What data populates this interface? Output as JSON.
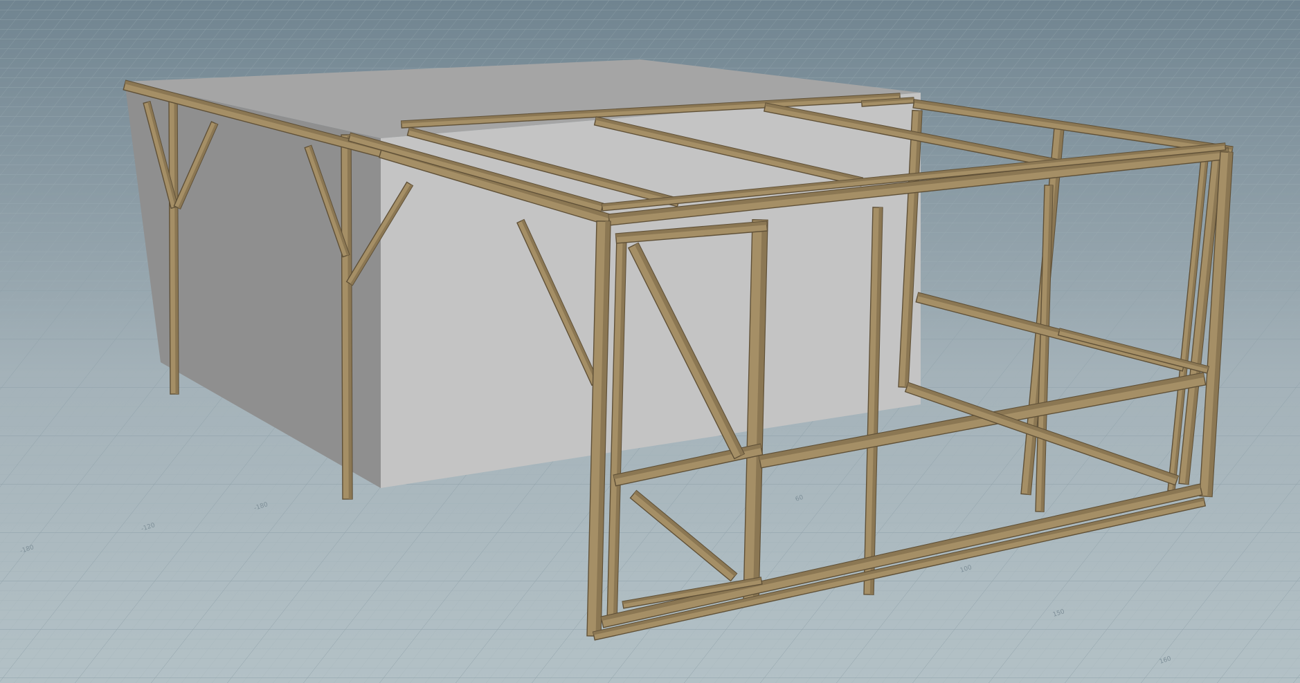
{
  "viewport": {
    "colors": {
      "sky_top": "#708490",
      "sky_bottom": "#a4b2b9",
      "grid_floor": "#b3c1c6",
      "grid_line_minor": "#9fb0b7",
      "grid_line_major": "#8a9ca5",
      "block_top": "#a5a5a5",
      "block_left": "#8f8f8f",
      "block_front": "#c4c4c4",
      "timber_light": "#a58f66",
      "timber_mid": "#8b7753",
      "timber_dark": "#5f5037"
    },
    "grid_labels": [
      "-180",
      "-120",
      "-180",
      "60",
      "100",
      "150",
      "160"
    ],
    "objects": {
      "block": "grey-block",
      "frame": "timber-frame"
    }
  }
}
